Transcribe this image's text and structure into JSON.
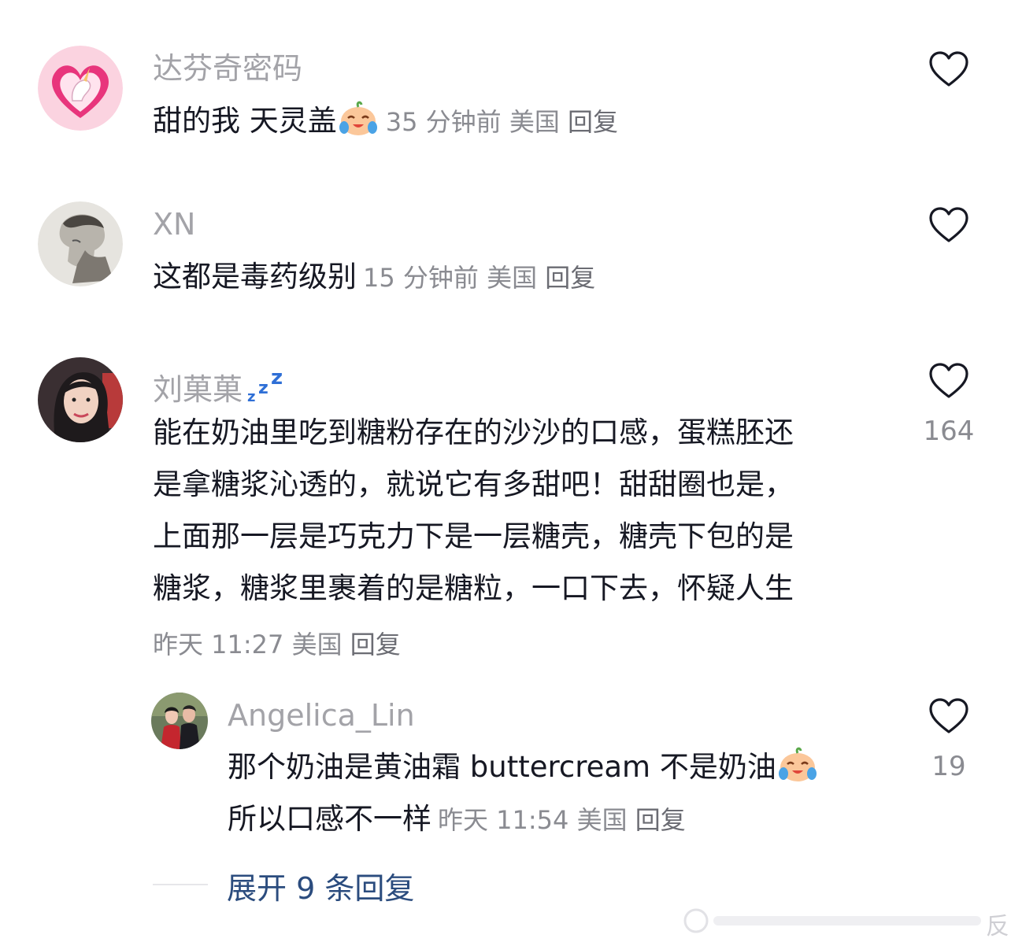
{
  "comments": [
    {
      "username": "达芬奇密码",
      "text": "甜的我 天灵盖",
      "time": "35 分钟前",
      "location": "美国",
      "reply_label": "回复",
      "likes": "",
      "avatar_icon": "unicorn-heart-avatar"
    },
    {
      "username": "XN",
      "text": "这都是毒药级别",
      "time": "15 分钟前",
      "location": "美国",
      "reply_label": "回复",
      "likes": "",
      "avatar_icon": "sketch-portrait-avatar"
    },
    {
      "username": "刘菓菓",
      "username_icon": "sleeping-zzz-icon",
      "lines": [
        "能在奶油里吃到糖粉存在的沙沙的口感，蛋糕胚还",
        "是拿糖浆沁透的，就说它有多甜吧！甜甜圈也是，",
        "上面那一层是巧克力下是一层糖壳，糖壳下包的是",
        "糖浆，糖浆里裹着的是糖粒，一口下去，怀疑人生"
      ],
      "time": "昨天 11:27",
      "location": "美国",
      "reply_label": "回复",
      "likes": "164",
      "avatar_icon": "woman-portrait-avatar"
    }
  ],
  "reply": {
    "username": "Angelica_Lin",
    "line1": "那个奶油是黄油霜 buttercream 不是奶油",
    "line2": "所以口感不一样",
    "time": "昨天 11:54",
    "location": "美国",
    "reply_label": "回复",
    "likes": "19",
    "avatar_icon": "couple-photo-avatar"
  },
  "expand_label": "展开 9 条回复",
  "watermark_text": "反",
  "colors": {
    "username": "#a3a3a8",
    "meta": "#8a8b91",
    "expand": "#2b4c7e",
    "heart_stroke": "#161823"
  }
}
